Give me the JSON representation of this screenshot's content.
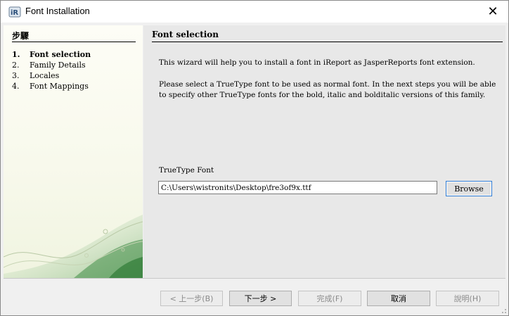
{
  "window": {
    "title": "Font Installation",
    "app_icon": "ireport-icon",
    "close_icon": "close-icon",
    "close_glyph": "✕"
  },
  "sidebar": {
    "header": "步驟",
    "steps": [
      {
        "num": "1.",
        "label": "Font selection",
        "active": true
      },
      {
        "num": "2.",
        "label": "Family Details",
        "active": false
      },
      {
        "num": "3.",
        "label": "Locales",
        "active": false
      },
      {
        "num": "4.",
        "label": "Font Mappings",
        "active": false
      }
    ]
  },
  "main": {
    "title": "Font selection",
    "intro": "This wizard will help you to install a font in iReport as JasperReports font extension.",
    "description": "Please select a TrueType font to be used as normal font. In the next steps you will be able to specify other TrueType fonts for the bold, italic and bolditalic versions of this family.",
    "font_label": "TrueType Font",
    "font_path": "C:\\Users\\wistronits\\Desktop\\fre3of9x.ttf",
    "browse_label": "Browse"
  },
  "buttons": {
    "back": "< 上一步(B)",
    "next": "下一步 >",
    "finish": "完成(F)",
    "cancel": "取消",
    "help": "說明(H)"
  },
  "colors": {
    "focus_border": "#2f7bd3",
    "sidebar_bg": "#f8f9ec",
    "content_bg": "#e8e8e8"
  }
}
